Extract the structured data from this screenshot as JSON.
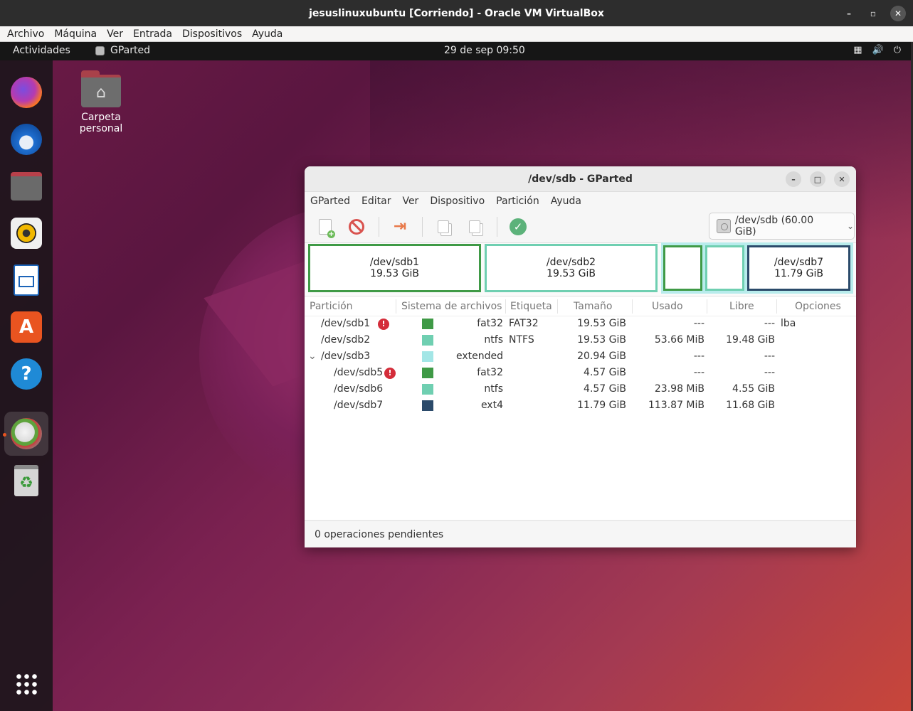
{
  "host": {
    "title": "jesuslinuxubuntu [Corriendo] - Oracle VM VirtualBox",
    "menu": [
      "Archivo",
      "Máquina",
      "Ver",
      "Entrada",
      "Dispositivos",
      "Ayuda"
    ]
  },
  "topbar": {
    "activities": "Actividades",
    "app_name": "GParted",
    "clock": "29 de sep  09:50"
  },
  "desktop": {
    "home_folder_label": "Carpeta personal"
  },
  "dock": {
    "items": [
      "firefox-icon",
      "thunderbird-icon",
      "files-icon",
      "rhythmbox-icon",
      "libreoffice-writer-icon",
      "app-center-icon",
      "help-icon",
      "gparted-icon",
      "trash-icon",
      "show-apps-icon"
    ]
  },
  "gparted": {
    "title": "/dev/sdb - GParted",
    "menu": [
      "GParted",
      "Editar",
      "Ver",
      "Dispositivo",
      "Partición",
      "Ayuda"
    ],
    "device_selector": "/dev/sdb (60.00 GiB)",
    "graph": {
      "sdb1": {
        "name": "/dev/sdb1",
        "size": "19.53 GiB",
        "color": "#3f9a46"
      },
      "sdb2": {
        "name": "/dev/sdb2",
        "size": "19.53 GiB",
        "color": "#6fcfb1"
      },
      "sdb7": {
        "name": "/dev/sdb7",
        "size": "11.79 GiB",
        "color": "#2b4a6a"
      },
      "extended_color": "#9ee3e3"
    },
    "columns": [
      "Partición",
      "Sistema de archivos",
      "Etiqueta",
      "Tamaño",
      "Usado",
      "Libre",
      "Opciones"
    ],
    "rows": [
      {
        "partition": "/dev/sdb1",
        "warning": true,
        "fs": "fat32",
        "color": "#3f9a46",
        "label": "FAT32",
        "size": "19.53 GiB",
        "used": "---",
        "free": "---",
        "flags": "lba"
      },
      {
        "partition": "/dev/sdb2",
        "warning": false,
        "fs": "ntfs",
        "color": "#6fcfb1",
        "label": "NTFS",
        "size": "19.53 GiB",
        "used": "53.66 MiB",
        "free": "19.48 GiB",
        "flags": ""
      },
      {
        "partition": "/dev/sdb3",
        "warning": false,
        "fs": "extended",
        "color": "#a3e6e6",
        "label": "",
        "size": "20.94 GiB",
        "used": "---",
        "free": "---",
        "flags": ""
      },
      {
        "partition": "/dev/sdb5",
        "warning": true,
        "fs": "fat32",
        "color": "#3f9a46",
        "label": "",
        "size": "4.57 GiB",
        "used": "---",
        "free": "---",
        "flags": ""
      },
      {
        "partition": "/dev/sdb6",
        "warning": false,
        "fs": "ntfs",
        "color": "#6fcfb1",
        "label": "",
        "size": "4.57 GiB",
        "used": "23.98 MiB",
        "free": "4.55 GiB",
        "flags": ""
      },
      {
        "partition": "/dev/sdb7",
        "warning": false,
        "fs": "ext4",
        "color": "#2b4a6a",
        "label": "",
        "size": "11.79 GiB",
        "used": "113.87 MiB",
        "free": "11.68 GiB",
        "flags": ""
      }
    ],
    "status": "0 operaciones pendientes"
  }
}
